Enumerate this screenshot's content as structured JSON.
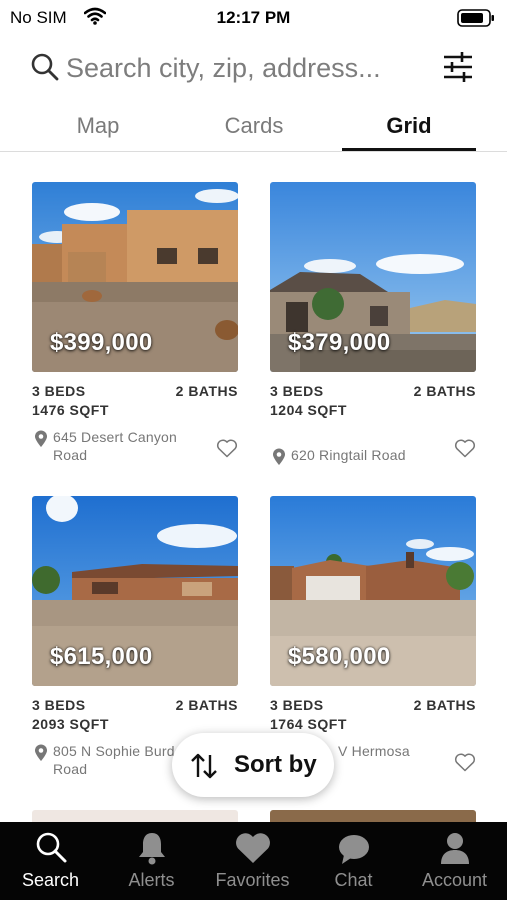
{
  "status_bar": {
    "carrier": "No SIM",
    "time": "12:17 PM"
  },
  "search": {
    "placeholder": "Search city, zip, address..."
  },
  "tabs": [
    {
      "label": "Map",
      "active": false
    },
    {
      "label": "Cards",
      "active": false
    },
    {
      "label": "Grid",
      "active": true
    }
  ],
  "listings": [
    {
      "price": "$399,000",
      "beds": "3 BEDS",
      "baths": "2 BATHS",
      "sqft": "1476 SQFT",
      "address": "645 Desert Canyon Road"
    },
    {
      "price": "$379,000",
      "beds": "3 BEDS",
      "baths": "2 BATHS",
      "sqft": "1204 SQFT",
      "address": "620 Ringtail Road"
    },
    {
      "price": "$615,000",
      "beds": "3 BEDS",
      "baths": "2 BATHS",
      "sqft": "2093 SQFT",
      "address": "805 N Sophie Burden Road"
    },
    {
      "price": "$580,000",
      "beds": "3 BEDS",
      "baths": "2 BATHS",
      "sqft": "1764 SQFT",
      "address": "V Hermosa"
    }
  ],
  "sort": {
    "label": "Sort by"
  },
  "bottom_nav": [
    {
      "label": "Search",
      "icon": "search-icon",
      "active": true
    },
    {
      "label": "Alerts",
      "icon": "bell-icon",
      "active": false
    },
    {
      "label": "Favorites",
      "icon": "heart-icon",
      "active": false
    },
    {
      "label": "Chat",
      "icon": "chat-bubble-icon",
      "active": false
    },
    {
      "label": "Account",
      "icon": "person-icon",
      "active": false
    }
  ],
  "colors": {
    "nav_background": "#050505",
    "nav_active": "#ffffff",
    "nav_inactive": "#8f8f8f",
    "muted_text": "#777777"
  }
}
